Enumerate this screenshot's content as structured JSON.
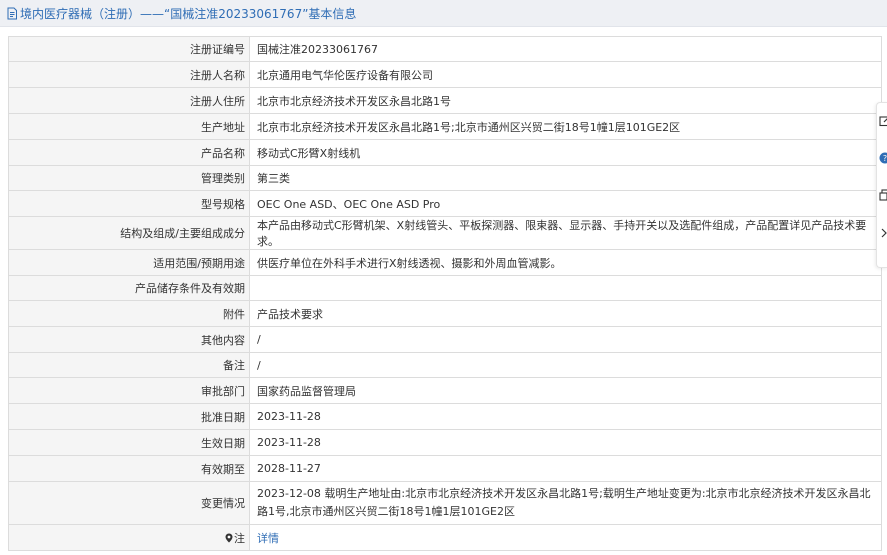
{
  "header": {
    "title": "境内医疗器械（注册）——“国械注准20233061767”基本信息"
  },
  "rows": [
    {
      "label": "注册证编号",
      "value": "国械注准20233061767"
    },
    {
      "label": "注册人名称",
      "value": "北京通用电气华伦医疗设备有限公司"
    },
    {
      "label": "注册人住所",
      "value": "北京市北京经济技术开发区永昌北路1号"
    },
    {
      "label": "生产地址",
      "value": "北京市北京经济技术开发区永昌北路1号;北京市通州区兴贸二街18号1幢1层101GE2区"
    },
    {
      "label": "产品名称",
      "value": "移动式C形臂X射线机"
    },
    {
      "label": "管理类别",
      "value": "第三类"
    },
    {
      "label": "型号规格",
      "value": "OEC One ASD、OEC One ASD Pro"
    },
    {
      "label": "结构及组成/主要组成成分",
      "value": "本产品由移动式C形臂机架、X射线管头、平板探测器、限束器、显示器、手持开关以及选配件组成，产品配置详见产品技术要求。"
    },
    {
      "label": "适用范围/预期用途",
      "value": "供医疗单位在外科手术进行X射线透视、摄影和外周血管减影。"
    },
    {
      "label": "产品储存条件及有效期",
      "value": ""
    },
    {
      "label": "附件",
      "value": "产品技术要求"
    },
    {
      "label": "其他内容",
      "value": "/"
    },
    {
      "label": "备注",
      "value": "/"
    },
    {
      "label": "审批部门",
      "value": "国家药品监督管理局"
    },
    {
      "label": "批准日期",
      "value": "2023-11-28"
    },
    {
      "label": "生效日期",
      "value": "2023-11-28"
    },
    {
      "label": "有效期至",
      "value": "2028-11-27"
    },
    {
      "label": "变更情况",
      "value": "2023-12-08 载明生产地址由:北京市北京经济技术开发区永昌北路1号;载明生产地址变更为:北京市北京经济技术开发区永昌北路1号,北京市通州区兴贸二街18号1幢1层101GE2区"
    },
    {
      "label": "注",
      "value": "详情"
    }
  ],
  "icons": {
    "title": "document-icon",
    "note": "location-pin-icon",
    "tools": [
      "edit-icon",
      "help-icon",
      "copy-icon",
      "chevron-right-icon"
    ]
  },
  "colors": {
    "link": "#2f6db5",
    "label_bg": "#f5f5f5",
    "header_bg": "#eef0f4",
    "help_icon": "#2f6db5"
  }
}
